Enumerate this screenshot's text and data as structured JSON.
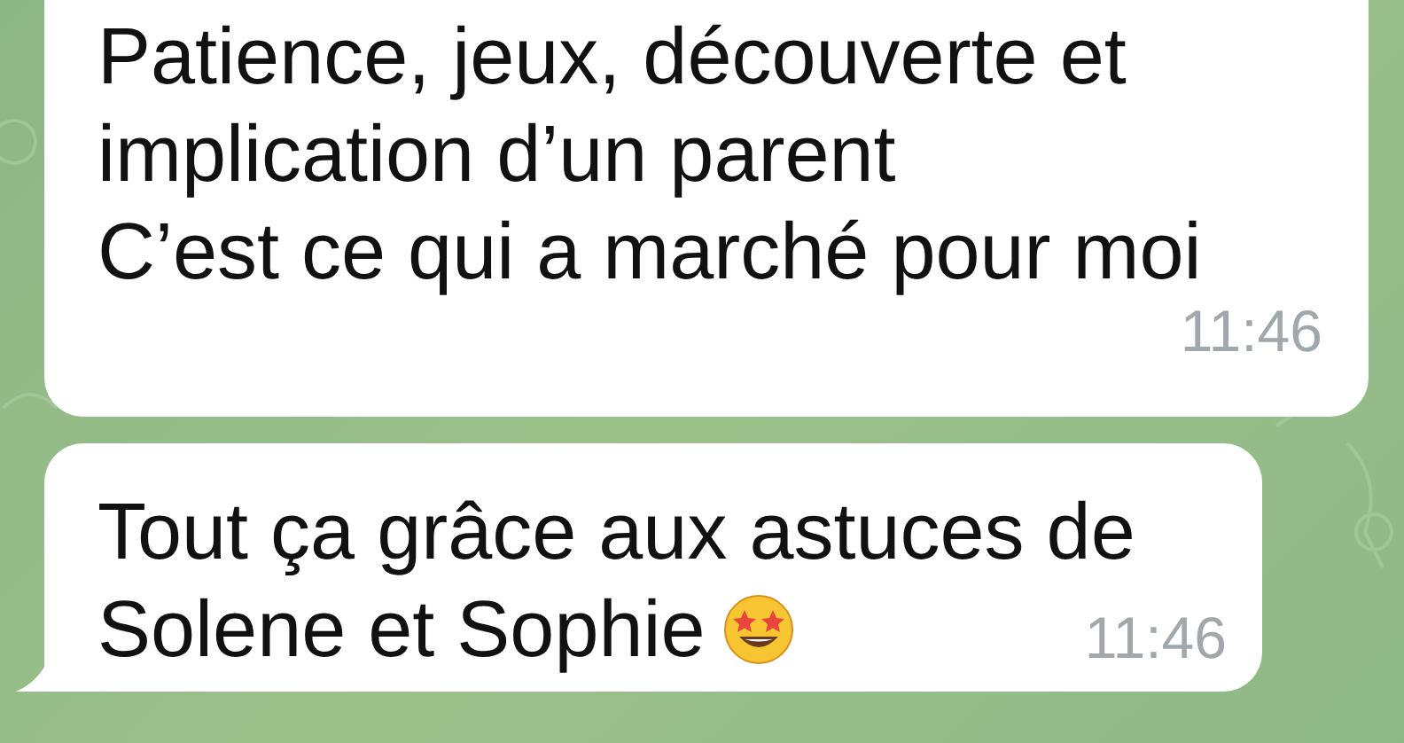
{
  "messages": [
    {
      "lines": [
        "Patience, jeux, découverte et",
        "implication d’un parent",
        "C’est ce qui a marché pour moi"
      ],
      "time": "11:46",
      "tail": false,
      "emoji": false
    },
    {
      "lines": [
        "Tout ça grâce aux astuces de",
        "Solene et Sophie"
      ],
      "time": "11:46",
      "tail": true,
      "emoji": true
    }
  ]
}
